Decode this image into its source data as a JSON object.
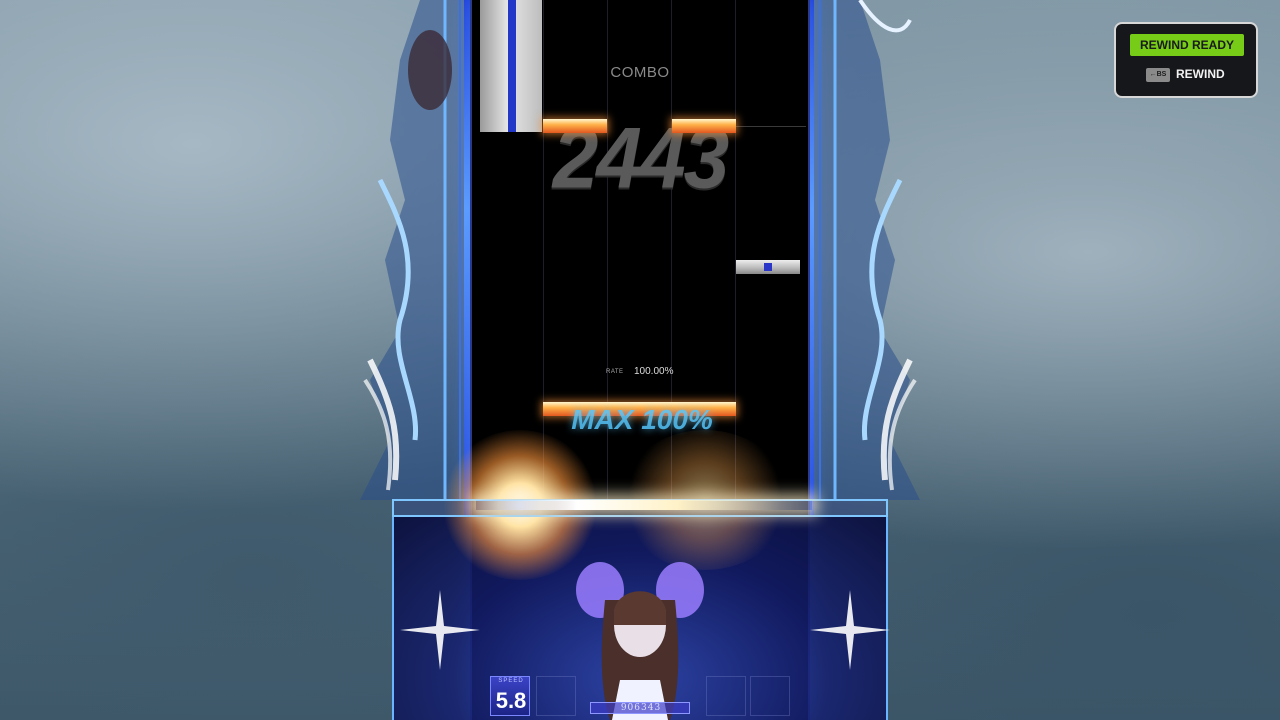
{
  "combo": {
    "label": "COMBO",
    "count": "2443"
  },
  "rate": {
    "label": "RATE",
    "value": "100.00%"
  },
  "max_indicator": "MAX 100%",
  "speed": {
    "label": "SPEED",
    "value": "5.8"
  },
  "score": "906343",
  "rewind": {
    "status": "REWIND READY",
    "key": "←BS",
    "label": "REWIND"
  },
  "colors": {
    "rewind_ready_bg": "#76cc17",
    "lane_frame": "#5fa0ff",
    "fx_note": "#ffb24a",
    "max_text": "#57c9ff"
  }
}
